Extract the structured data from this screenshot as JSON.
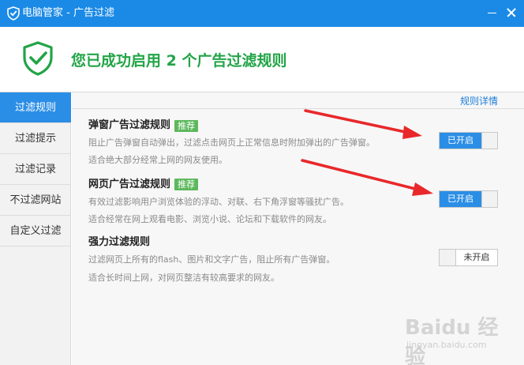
{
  "window": {
    "title": "电脑管家 - 广告过滤",
    "logo_icon": "shield-logo-icon",
    "minimize_icon": "minimize-icon",
    "close_icon": "close-icon",
    "titlebar_color": "#1b8ae6"
  },
  "banner": {
    "icon": "shield-check-icon",
    "headline": "您已成功启用 2 个广告过滤规则",
    "headline_color": "#22a447"
  },
  "sidebar": {
    "items": [
      {
        "label": "过滤规则",
        "active": true
      },
      {
        "label": "过滤提示",
        "active": false
      },
      {
        "label": "过滤记录",
        "active": false
      },
      {
        "label": "不过滤网站",
        "active": false
      },
      {
        "label": "自定义过滤",
        "active": false
      }
    ],
    "active_color": "#2b8ee6"
  },
  "main": {
    "detail_link": "规则详情",
    "rules": [
      {
        "title": "弹窗广告过滤规则",
        "badge": "推荐",
        "desc1": "阻止广告弹窗自动弹出，过滤点击网页上正常信息时附加弹出的广告弹窗。",
        "desc2": "适合绝大部分经常上网的网友使用。",
        "toggle_label": "已开启",
        "enabled": true
      },
      {
        "title": "网页广告过滤规则",
        "badge": "推荐",
        "desc1": "有效过滤影响用户浏览体验的浮动、对联、右下角浮窗等骚扰广告。",
        "desc2": "适合经常在网上观看电影、浏览小说、论坛和下载软件的网友。",
        "toggle_label": "已开启",
        "enabled": true
      },
      {
        "title": "强力过滤规则",
        "desc1": "过滤网页上所有的flash、图片和文字广告，阻止所有广告弹窗。",
        "desc2": "适合长时间上网，对网页整洁有较高要求的网友。",
        "toggle_label": "未开启",
        "enabled": false
      }
    ],
    "badge_color": "#5cb85c",
    "arrow_color": "#e8282b"
  },
  "watermark": {
    "text": "Baidu 经验",
    "url": "jingyan.baidu.com"
  }
}
